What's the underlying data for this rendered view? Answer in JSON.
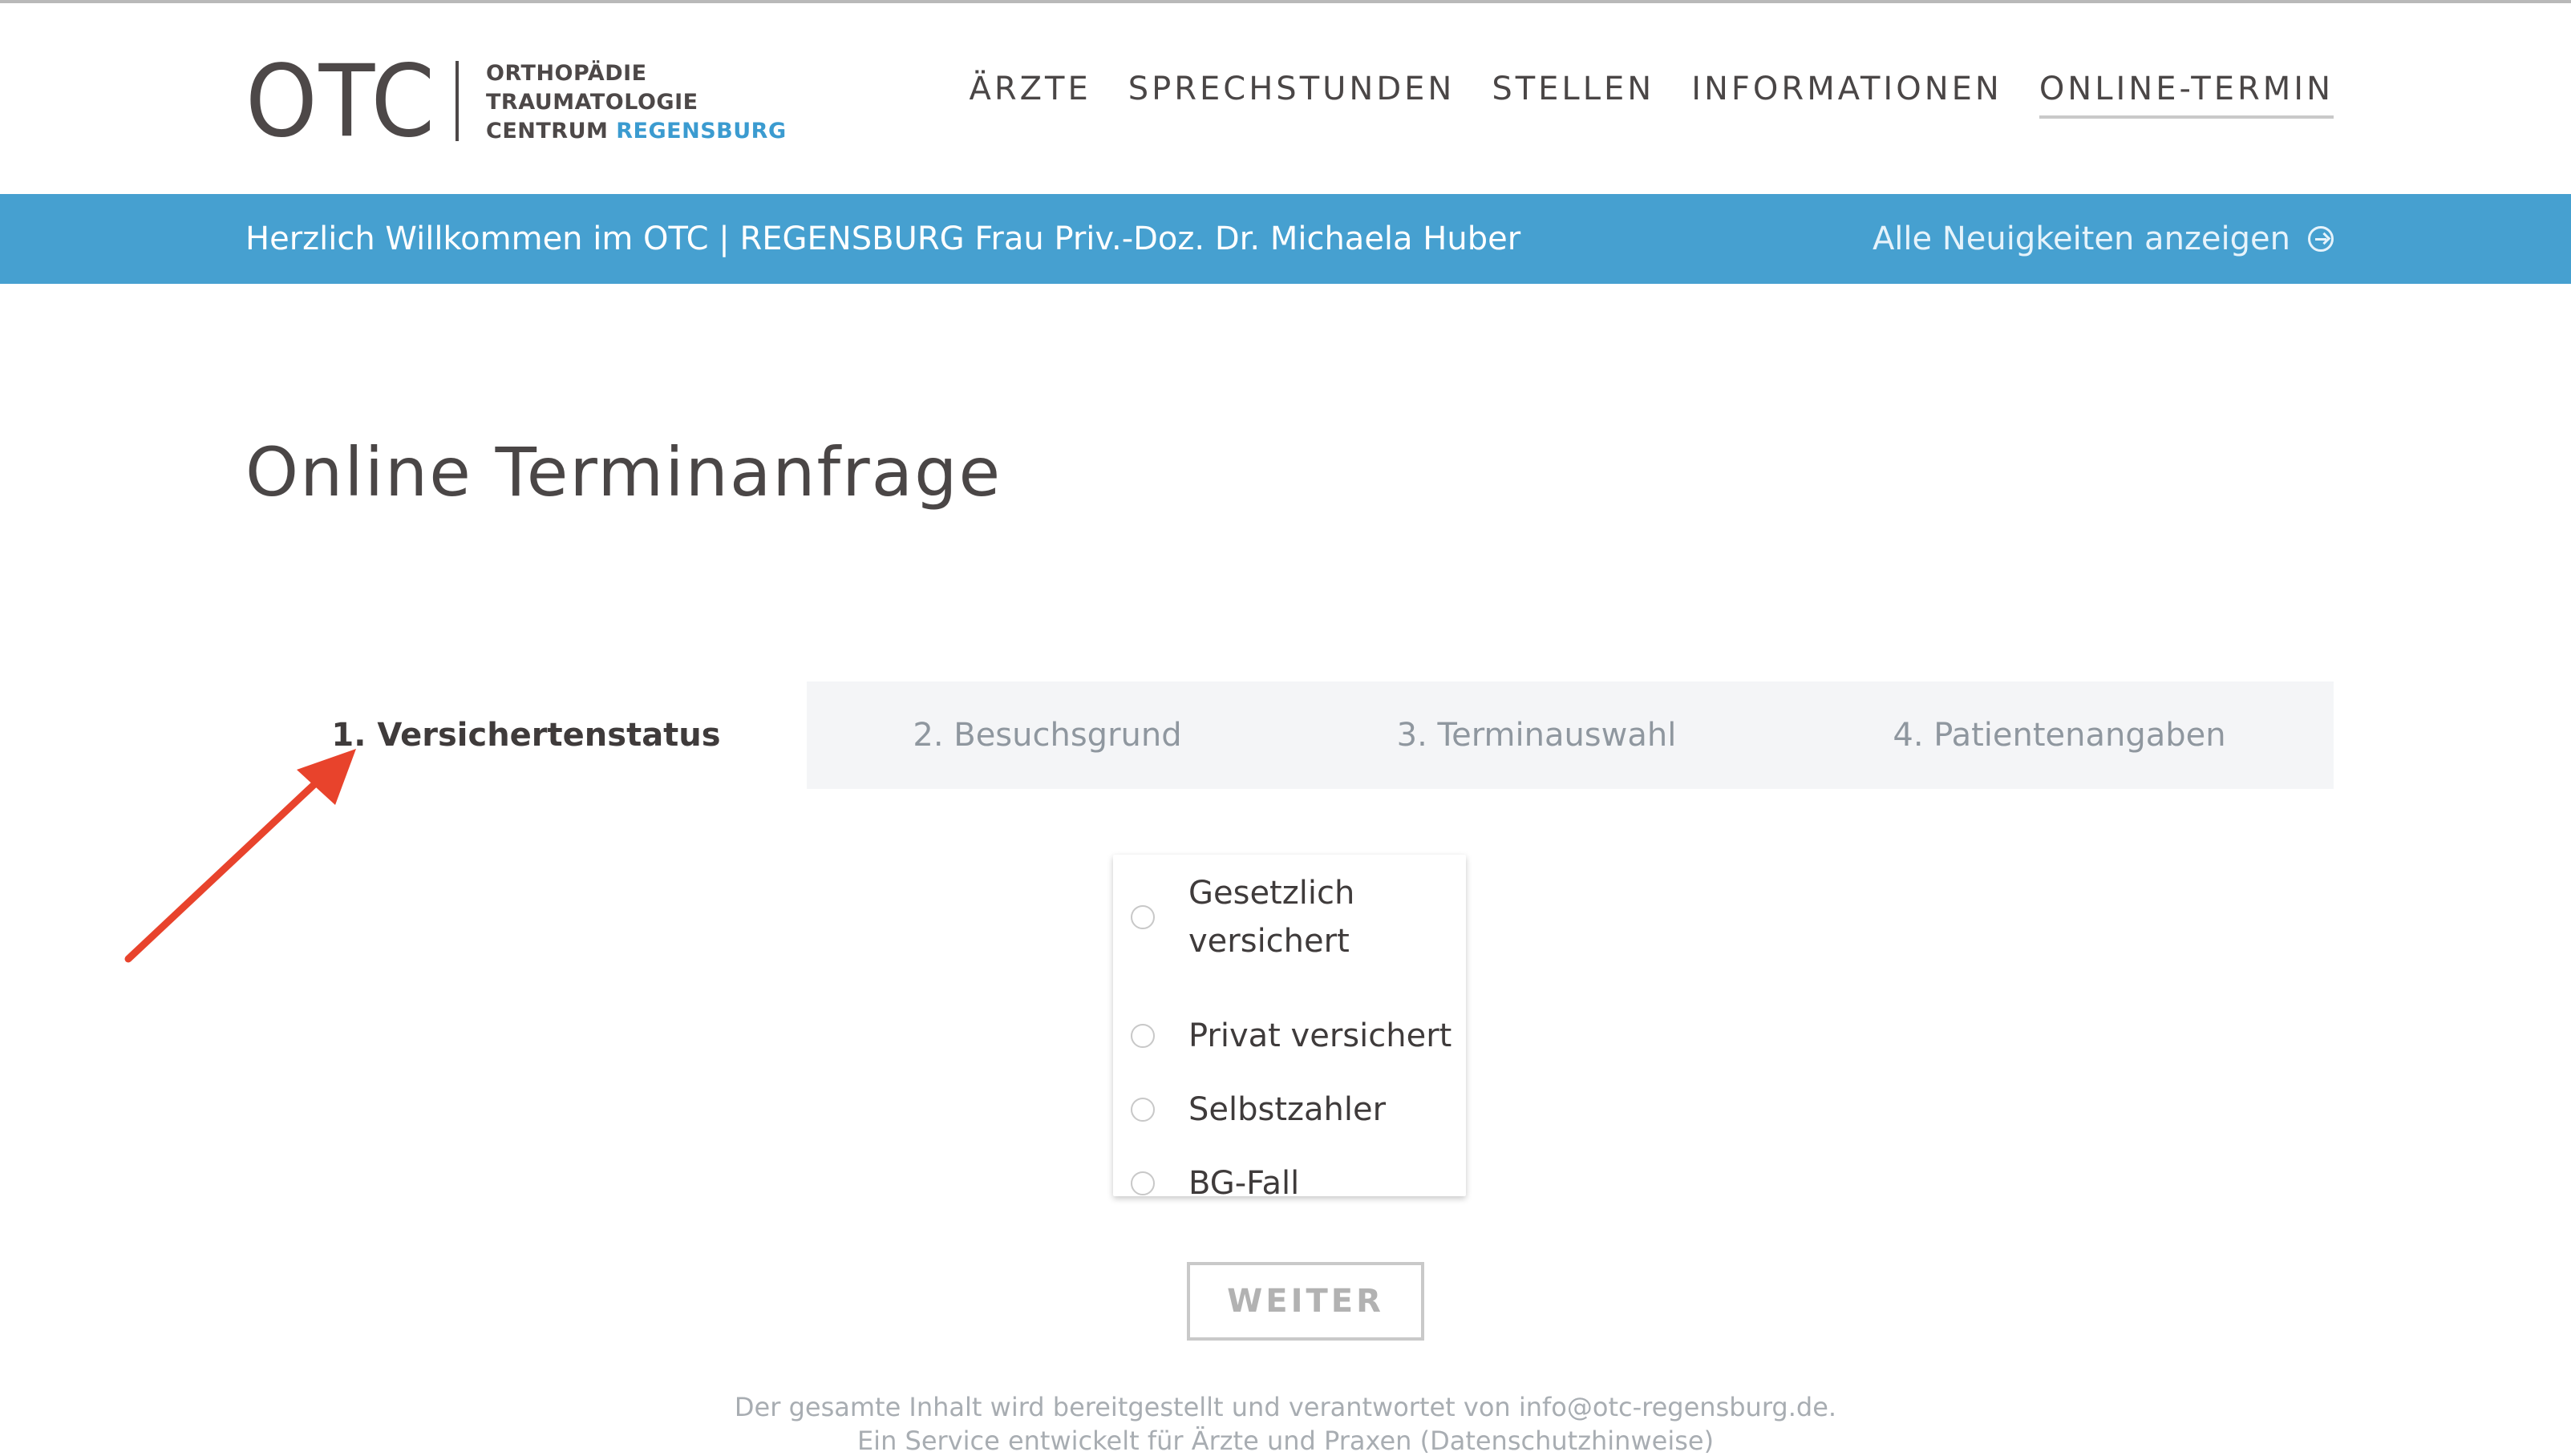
{
  "header": {
    "logo_mark": "OTC",
    "logo_lines": [
      "ORTHOPÄDIE",
      "TRAUMATOLOGIE",
      "CENTRUM"
    ],
    "logo_accent": "REGENSBURG",
    "nav": [
      {
        "label": "ÄRZTE",
        "active": false
      },
      {
        "label": "SPRECHSTUNDEN",
        "active": false
      },
      {
        "label": "STELLEN",
        "active": false
      },
      {
        "label": "INFORMATIONEN",
        "active": false
      },
      {
        "label": "ONLINE-TERMIN",
        "active": true
      }
    ]
  },
  "banner": {
    "message": "Herzlich Willkommen im OTC | REGENSBURG Frau Priv.-Doz. Dr. Michaela Huber",
    "link": "Alle Neuigkeiten anzeigen",
    "link_icon": "arrow-right-circle-icon",
    "color": "#46a0d0"
  },
  "page": {
    "title": "Online Terminanfrage"
  },
  "steps": [
    {
      "label": "1. Versichertenstatus",
      "active": true
    },
    {
      "label": "2. Besuchsgrund",
      "active": false
    },
    {
      "label": "3. Terminauswahl",
      "active": false
    },
    {
      "label": "4. Patientenangaben",
      "active": false
    }
  ],
  "insurance_options": [
    {
      "label": "Gesetzlich versichert",
      "checked": false
    },
    {
      "label": "Privat versichert",
      "checked": false
    },
    {
      "label": "Selbstzahler",
      "checked": false
    },
    {
      "label": "BG-Fall",
      "checked": false
    }
  ],
  "form": {
    "next_label": "WEITER"
  },
  "footer": {
    "line1": "Der gesamte Inhalt wird bereitgestellt und verantwortet von info@otc-regensburg.de.",
    "line2": "Ein Service entwickelt für Ärzte und Praxen (Datenschutzhinweise)"
  },
  "annotation": {
    "color": "#e8432c"
  }
}
